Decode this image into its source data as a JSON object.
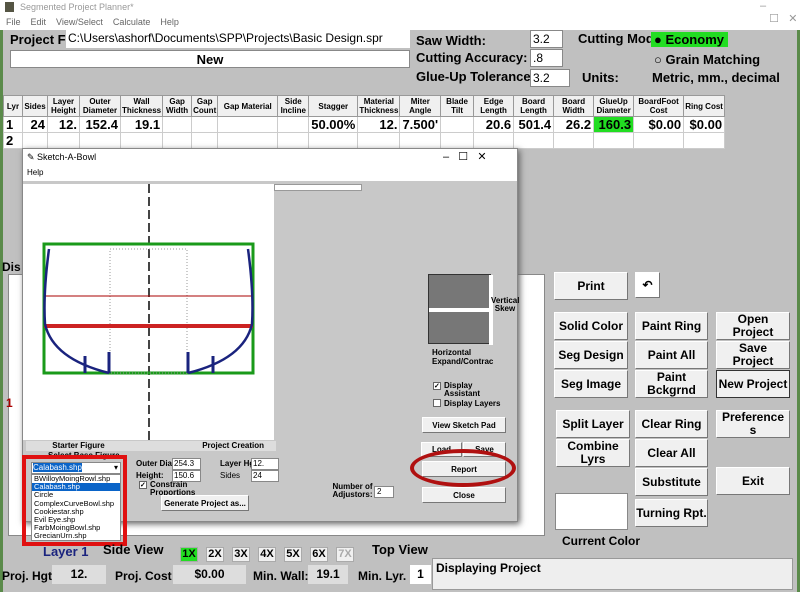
{
  "window": {
    "title": "Segmented Project Planner*",
    "menu": [
      "File",
      "Edit",
      "View/Select",
      "Calculate",
      "Help"
    ]
  },
  "project": {
    "file_label": "Project File",
    "file_path": "C:\\Users\\ashorf\\Documents\\SPP\\Projects\\Basic Design.spr",
    "name": "New"
  },
  "settings": {
    "saw_width_label": "Saw Width:",
    "saw_width": "3.2",
    "cutting_accuracy_label": "Cutting Accuracy:",
    "cutting_accuracy": ".8",
    "glue_up_label": "Glue-Up Tolerance:",
    "glue_up": "3.2",
    "cutting_mode_label": "Cutting Mode",
    "mode_economy": "Economy",
    "mode_grain": "Grain Matching",
    "selected_mode": "Economy",
    "units_label": "Units:",
    "units": "Metric, mm., decimal",
    "accent_green": "#22dd22"
  },
  "table": {
    "headers": [
      "Lyr",
      "Sides",
      "Layer Height",
      "Outer Diameter",
      "Wall Thickness",
      "Gap Width",
      "Gap Count",
      "Gap Material",
      "Side Incline",
      "Stagger",
      "Material Thickness",
      "Miter Angle",
      "Blade Tilt",
      "Edge Length",
      "Board Length",
      "Board Width",
      "GlueUp Diameter",
      "BoardFoot Cost",
      "Ring Cost"
    ],
    "rows": [
      [
        "1",
        "24",
        "12.",
        "152.4",
        "19.1",
        "",
        "",
        "",
        "",
        "50.00%",
        "12.",
        "7.500'",
        "",
        "20.6",
        "501.4",
        "26.2",
        "160.3",
        "$0.00",
        "$0.00"
      ],
      [
        "2",
        "",
        "",
        "",
        "",
        "",
        "",
        "",
        "",
        "",
        "",
        "",
        "",
        "",
        "",
        "",
        "",
        "",
        ""
      ]
    ]
  },
  "main": {
    "display_label": "Dis",
    "layer_marker": "1"
  },
  "dialog": {
    "title": "Sketch-A-Bowl",
    "menu": "Help",
    "starter_figure": "Starter Figure",
    "project_creation": "Project Creation",
    "select_base": "Select Base Figure",
    "selected_shape": "Calabash.shp",
    "shapes": [
      "BWilloyMoingRowl.shp",
      "Calabash.shp",
      "Circle",
      "ComplexCurveBowl.shp",
      "Cookiestar.shp",
      "Evil Eye.shp",
      "FarbMoingBowl.shp",
      "GrecianUrn.shp"
    ],
    "outer_dia_label": "Outer Dia",
    "outer_dia": "254.3",
    "height_label": "Height:",
    "height": "150.6",
    "layer_hg_label": "Layer Hg",
    "layer_hg": "12.",
    "sides_label": "Sides",
    "sides": "24",
    "constrain_label": "Constrain Proportions",
    "constrain": true,
    "generate": "Generate Project as...",
    "vertical_skew": "Vertical Skew",
    "horizontal": "Horizontal Expand/Contrac",
    "display_assistant": "Display Assistant",
    "display_assistant_checked": true,
    "display_layers": "Display Layers",
    "display_layers_checked": false,
    "view_sketch_pad": "View Sketch Pad",
    "btn_left": "Load",
    "btn_right": "Save",
    "report": "Report",
    "close": "Close",
    "adjustors_label": "Number of Adjustors:",
    "adjustors": "2"
  },
  "buttons": {
    "print": "Print",
    "undo_icon": "undo-icon",
    "solid_color": "Solid Color",
    "paint_ring": "Paint Ring",
    "open_project": "Open Project",
    "seg_design": "Seg Design",
    "paint_all": "Paint All",
    "save_project": "Save Project",
    "seg_image": "Seg Image",
    "paint_bckgrnd": "Paint Bckgrnd",
    "new_project": "New Project",
    "split_layer": "Split Layer",
    "clear_ring": "Clear Ring",
    "preferences": "Preference s",
    "combine_lyrs": "Combine Lyrs",
    "clear_all": "Clear All",
    "substitute": "Substitute",
    "exit": "Exit",
    "turning_rpt": "Turning Rpt.",
    "current_color": "Current Color"
  },
  "bottom": {
    "layer": "Layer 1",
    "side_view": "Side View",
    "zoom": [
      "1X",
      "2X",
      "3X",
      "4X",
      "5X",
      "6X",
      "7X"
    ],
    "zoom_selected": "1X",
    "top_view": "Top View",
    "proj_hgt_label": "Proj. Hgt",
    "proj_hgt": "12.",
    "proj_cost_label": "Proj. Cost",
    "proj_cost": "$0.00",
    "min_wall_label": "Min. Wall:",
    "min_wall": "19.1",
    "min_lyr_label": "Min. Lyr.",
    "min_lyr": "1",
    "status": "Displaying Project"
  }
}
